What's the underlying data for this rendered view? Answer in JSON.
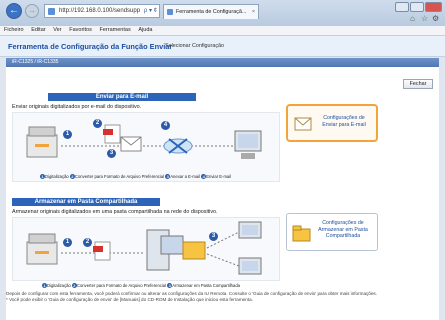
{
  "browser": {
    "address": "http://192.168.0.100/sendsupp",
    "address_controls": "ρ ▾ ¢",
    "tab_title": "Ferramenta de Configuraçã...",
    "tab_close": "×",
    "menu": [
      "Ficheiro",
      "Editar",
      "Ver",
      "Favoritos",
      "Ferramentas",
      "Ajuda"
    ]
  },
  "header": {
    "title": "Ferramenta de Configuração da Função Enviar",
    "subtitle": "Selecionar Configuração"
  },
  "info_bar": "iR-C1325 / iR-C1335",
  "close_button": "Fechar",
  "email": {
    "section_title": "Enviar para E-mail",
    "description": "Enviar originais digitalizados por e-mail do dispositivo.",
    "button_label_1": "Configurações de",
    "button_label_2": "Enviar para E-mail",
    "steps": [
      "1",
      "2",
      "3",
      "4"
    ],
    "legend": [
      "Digitalização",
      "Converter para Formato de Arquivo Preferencial",
      "Anexar a E-mail",
      "Enviar E-mail"
    ]
  },
  "folder": {
    "section_title": "Armazenar em Pasta Compartilhada",
    "description": "Armazenar originais digitalizados em uma pasta compartilhada na rede do dispositivo.",
    "button_label_1": "Configurações de",
    "button_label_2": "Armazenar em Pasta",
    "button_label_3": "Compartilhada",
    "steps": [
      "1",
      "2",
      "3"
    ],
    "legend": [
      "Digitalização",
      "Converter para Formato de Arquivo Preferencial",
      "Armazenar em Pasta Compartilhada"
    ]
  },
  "footer": {
    "line1": "Depois de configurar com esta ferramenta, você poderá confirmar ou alterar as configurações da IU Remota. Consulte o 'Guia de configuração de envio' para obter mais informações.",
    "line2": "* Você pode exibir o 'Guia de configuração de envio' de [Manuais] do CD-ROM de Instalação que iniciou esta ferramenta."
  },
  "colors": {
    "accent": "#2b64b8",
    "highlight": "#f2a33a",
    "title": "#1d4fa1"
  }
}
